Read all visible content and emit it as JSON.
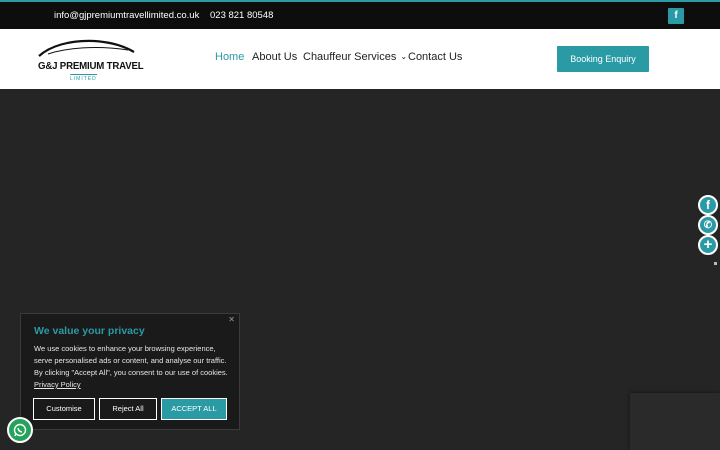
{
  "topbar": {
    "email": "info@gjpremiumtravellimited.co.uk",
    "phone": "023 821 80548",
    "facebook_icon": "facebook-icon",
    "facebook_glyph": "f"
  },
  "logo": {
    "name": "G&J PREMIUM TRAVEL",
    "sub": "LIMITED"
  },
  "nav": {
    "home": "Home",
    "about": "About Us",
    "services": "Chauffeur Services",
    "services_chevron": "⌄",
    "contact": "Contact Us"
  },
  "booking_button": "Booking Enquiry",
  "share": {
    "facebook_glyph": "f",
    "whatsapp_glyph": "✆",
    "more_glyph": "+"
  },
  "cookie": {
    "close_glyph": "✕",
    "title": "We value your privacy",
    "body": "We use cookies to enhance your browsing experience, serve personalised ads or content, and analyse our traffic. By clicking \"Accept All\", you consent to our use of cookies.",
    "policy_link": "Privacy Policy",
    "customise": "Customise",
    "reject": "Reject All",
    "accept": "ACCEPT ALL"
  },
  "colors": {
    "accent": "#2a9aa5",
    "hero_background": "#252525",
    "topbar_background": "#0d0d0d"
  }
}
